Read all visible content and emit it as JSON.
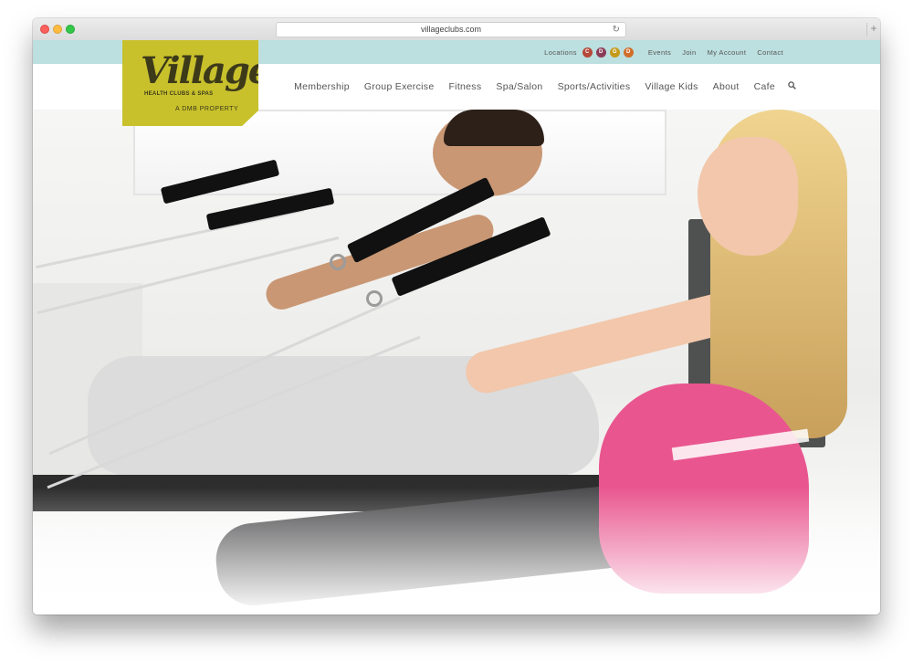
{
  "browser": {
    "url": "villageclubs.com"
  },
  "topbar": {
    "locations_label": "Locations",
    "location_badges": [
      {
        "letter": "C",
        "color": "#b5493a"
      },
      {
        "letter": "D",
        "color": "#8b3b56"
      },
      {
        "letter": "G",
        "color": "#c49a1a"
      },
      {
        "letter": "D",
        "color": "#d06e2a"
      }
    ],
    "links": [
      "Events",
      "Join",
      "My Account",
      "Contact"
    ]
  },
  "logo": {
    "wordmark": "Village",
    "subtitle": "HEALTH CLUBS & SPAS",
    "property": "A DMB PROPERTY",
    "color": "#c8c12c"
  },
  "nav": {
    "items": [
      "Membership",
      "Group Exercise",
      "Fitness",
      "Spa/Salon",
      "Sports/Activities",
      "Village Kids",
      "About",
      "Cafe"
    ],
    "search_icon": "search-icon"
  }
}
